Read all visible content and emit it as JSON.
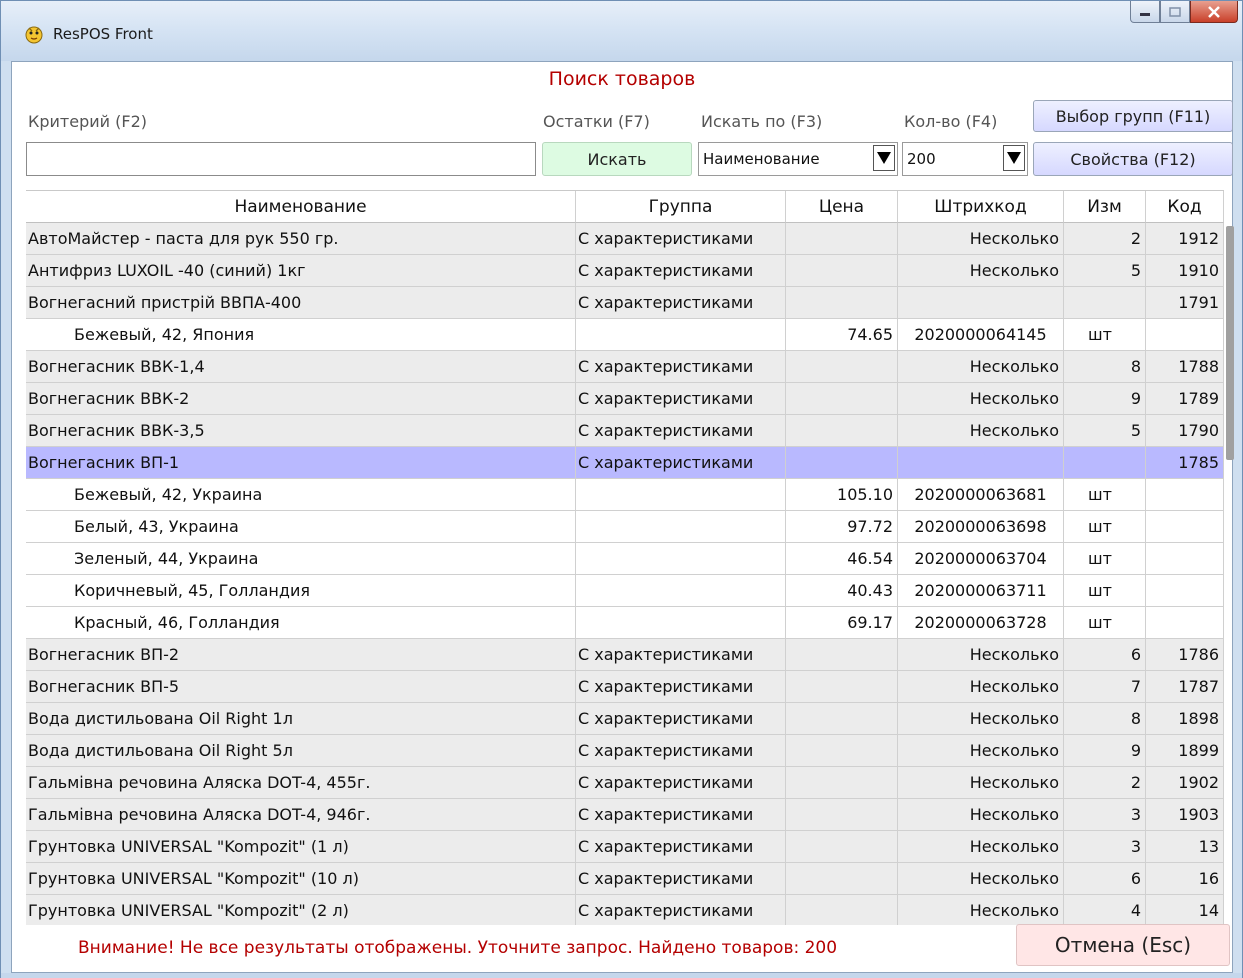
{
  "window": {
    "title": "ResPOS Front"
  },
  "heading": "Поиск товаров",
  "labels": {
    "criteria": "Критерий (F2)",
    "stock": "Остатки (F7)",
    "search_by": "Искать по (F3)",
    "quantity": "Кол-во (F4)"
  },
  "buttons": {
    "select_groups": "Выбор групп (F11)",
    "search": "Искать",
    "properties": "Свойства (F12)",
    "cancel": "Отмена (Esc)"
  },
  "inputs": {
    "criteria_value": "",
    "search_by_value": "Наименование",
    "quantity_value": "200"
  },
  "table": {
    "columns": [
      "Наименование",
      "Группа",
      "Цена",
      "Штрихкод",
      "Изм",
      "Код"
    ],
    "rows": [
      {
        "type": "group",
        "cells": [
          "АвтоМайстер - паста для рук 550 гр.",
          "С характеристиками",
          "",
          "Несколько",
          "2",
          "1912"
        ]
      },
      {
        "type": "group",
        "cells": [
          "Антифриз LUXOIL -40 (синий) 1кг",
          "С характеристиками",
          "",
          "Несколько",
          "5",
          "1910"
        ]
      },
      {
        "type": "group",
        "cells": [
          "Вогнегасний пристрій ВВПА-400",
          "С характеристиками",
          "",
          "",
          "",
          "1791"
        ]
      },
      {
        "type": "variant",
        "cells": [
          "Бежевый, 42, Япония",
          "",
          "74.65",
          "2020000064145",
          "шт",
          ""
        ]
      },
      {
        "type": "group",
        "cells": [
          "Вогнегасник ВВК-1,4",
          "С характеристиками",
          "",
          "Несколько",
          "8",
          "1788"
        ]
      },
      {
        "type": "group",
        "cells": [
          "Вогнегасник ВВК-2",
          "С характеристиками",
          "",
          "Несколько",
          "9",
          "1789"
        ]
      },
      {
        "type": "group",
        "cells": [
          "Вогнегасник ВВК-3,5",
          "С характеристиками",
          "",
          "Несколько",
          "5",
          "1790"
        ]
      },
      {
        "type": "selected",
        "cells": [
          "Вогнегасник ВП-1",
          "С характеристиками",
          "",
          "",
          "",
          "1785"
        ]
      },
      {
        "type": "variant",
        "cells": [
          "Бежевый, 42, Украина",
          "",
          "105.10",
          "2020000063681",
          "шт",
          ""
        ]
      },
      {
        "type": "variant",
        "cells": [
          "Белый, 43, Украина",
          "",
          "97.72",
          "2020000063698",
          "шт",
          ""
        ]
      },
      {
        "type": "variant",
        "cells": [
          "Зеленый, 44, Украина",
          "",
          "46.54",
          "2020000063704",
          "шт",
          ""
        ]
      },
      {
        "type": "variant",
        "cells": [
          "Коричневый, 45, Голландия",
          "",
          "40.43",
          "2020000063711",
          "шт",
          ""
        ]
      },
      {
        "type": "variant",
        "cells": [
          "Красный, 46, Голландия",
          "",
          "69.17",
          "2020000063728",
          "шт",
          ""
        ]
      },
      {
        "type": "group",
        "cells": [
          "Вогнегасник ВП-2",
          "С характеристиками",
          "",
          "Несколько",
          "6",
          "1786"
        ]
      },
      {
        "type": "group",
        "cells": [
          "Вогнегасник ВП-5",
          "С характеристиками",
          "",
          "Несколько",
          "7",
          "1787"
        ]
      },
      {
        "type": "group",
        "cells": [
          "Вода дистильована  Oil Right 1л",
          "С характеристиками",
          "",
          "Несколько",
          "8",
          "1898"
        ]
      },
      {
        "type": "group",
        "cells": [
          "Вода дистильована Oil Right 5л",
          "С характеристиками",
          "",
          "Несколько",
          "9",
          "1899"
        ]
      },
      {
        "type": "group",
        "cells": [
          "Гальмівна речовина Аляска DOT-4, 455г.",
          "С характеристиками",
          "",
          "Несколько",
          "2",
          "1902"
        ]
      },
      {
        "type": "group",
        "cells": [
          "Гальмівна речовина Аляска DOT-4, 946г.",
          "С характеристиками",
          "",
          "Несколько",
          "3",
          "1903"
        ]
      },
      {
        "type": "group",
        "cells": [
          "Грунтовка UNIVERSAL \"Kompozit\" (1 л)",
          "С характеристиками",
          "",
          "Несколько",
          "3",
          "13"
        ]
      },
      {
        "type": "group",
        "cells": [
          "Грунтовка UNIVERSAL \"Kompozit\" (10 л)",
          "С характеристиками",
          "",
          "Несколько",
          "6",
          "16"
        ]
      },
      {
        "type": "group",
        "cells": [
          "Грунтовка UNIVERSAL \"Kompozit\" (2 л)",
          "С характеристиками",
          "",
          "Несколько",
          "4",
          "14"
        ]
      }
    ]
  },
  "status_message": "Внимание! Не все результаты отображены. Уточните запрос. Найдено товаров: 200",
  "colors": {
    "heading": "#b40000",
    "selected_row": "#b9b9ff",
    "group_row": "#ececec"
  },
  "icons": {
    "app": "chicken-icon",
    "dropdown": "triangle-down-icon"
  }
}
